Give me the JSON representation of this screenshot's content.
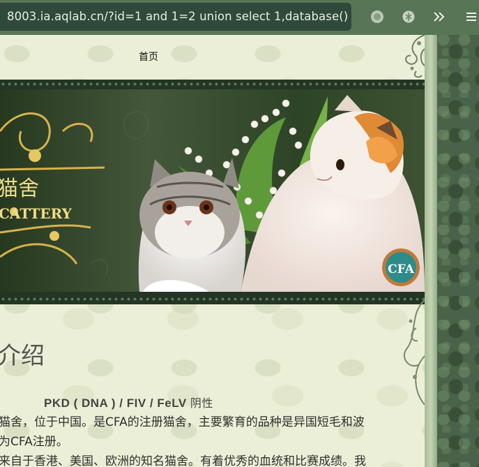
{
  "browser": {
    "url_prefix": "8003.ia.aqlab.cn/?id=1 and 1=2 union select 1,database()",
    "icons": [
      "search-icon",
      "record-icon",
      "extension-icon",
      "more-tabs-icon",
      "menu-icon"
    ]
  },
  "nav": {
    "home_label": "首页"
  },
  "banner": {
    "brand_text": "猫舍",
    "brand_sub": "CATTERY",
    "badge_text": "CFA"
  },
  "content": {
    "section_title": "介绍",
    "tests_line": "PKD ( DNA ) / FIV / FeLV",
    "tests_suffix": "阴性",
    "lines": [
      "猫舍，位于中国。是CFA的注册猫舍，主要繁育的品种是异国短毛和波",
      "为CFA注册。",
      "来自于香港、美国、欧洲的知名猫舍。有着优秀的血统和比赛成绩。我"
    ]
  },
  "colors": {
    "toolbar": "#587555",
    "urlbar": "#2f4a3b",
    "page_bg": "#ecefd7",
    "frame": "#4a6249"
  }
}
